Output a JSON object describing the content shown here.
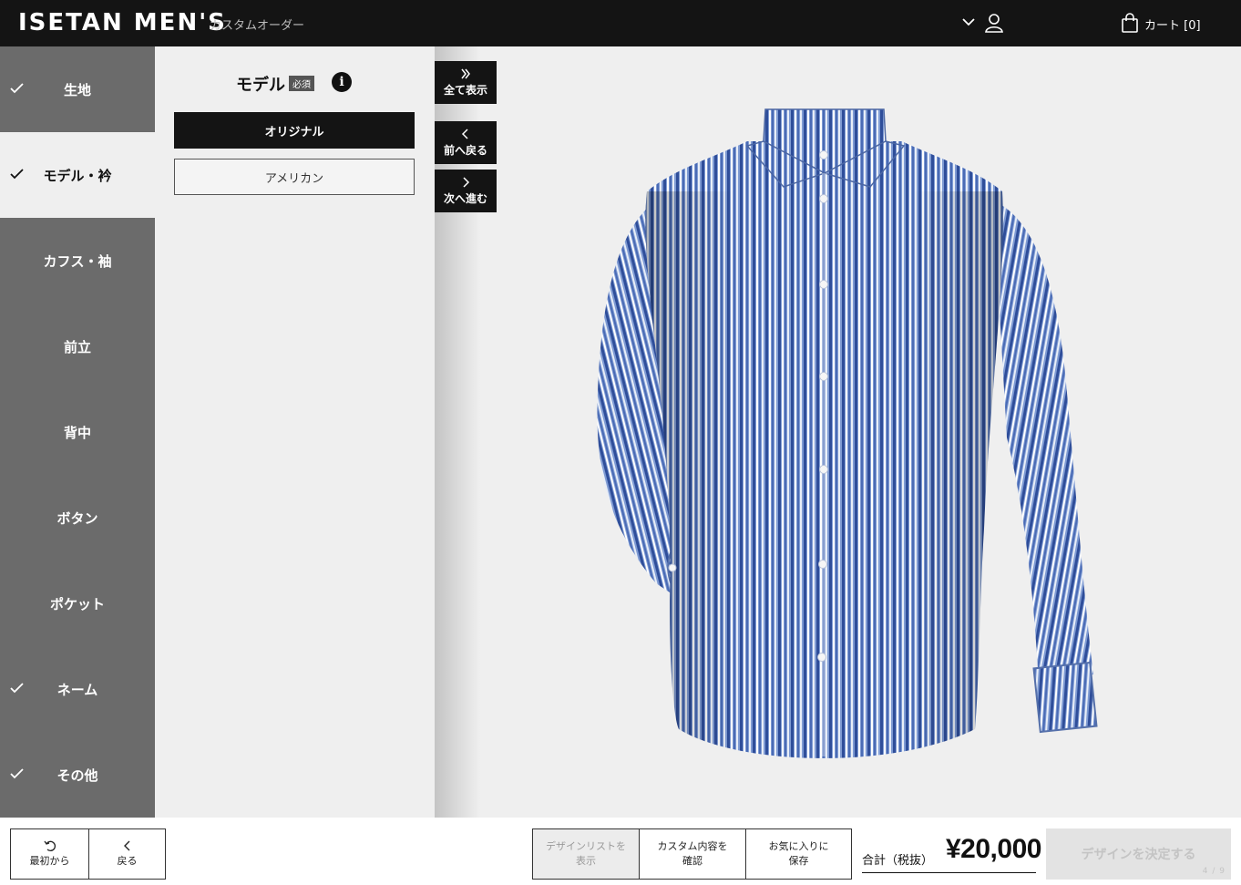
{
  "header": {
    "logo": "ISETAN MEN'S",
    "subtitle": "カスタムオーダー",
    "cart_label": "カート [0]"
  },
  "sidebar": {
    "items": [
      {
        "label": "生地",
        "checked": true
      },
      {
        "label": "モデル・衿",
        "checked": true,
        "active": true
      },
      {
        "label": "カフス・袖",
        "checked": false
      },
      {
        "label": "前立",
        "checked": false
      },
      {
        "label": "背中",
        "checked": false
      },
      {
        "label": "ボタン",
        "checked": false
      },
      {
        "label": "ポケット",
        "checked": false
      },
      {
        "label": "ネーム",
        "checked": true
      },
      {
        "label": "その他",
        "checked": true
      }
    ]
  },
  "panel": {
    "title": "モデル",
    "required_badge": "必須",
    "info_icon": "i",
    "options": [
      {
        "label": "オリジナル",
        "selected": true
      },
      {
        "label": "アメリカン",
        "selected": false
      }
    ]
  },
  "side_buttons": {
    "show_all": "全て表示",
    "prev": "前へ戻る",
    "next": "次へ進む"
  },
  "footer": {
    "restart": "最初から",
    "back": "戻る",
    "design_list_1": "デザインリストを",
    "design_list_2": "表示",
    "confirm_1": "カスタム内容を",
    "confirm_2": "確認",
    "favorite_1": "お気に入りに",
    "favorite_2": "保存",
    "total_label": "合計（税抜）",
    "total_price": "¥20,000",
    "decide": "デザインを決定する",
    "step": "4 / 9"
  },
  "colors": {
    "header_bg": "#141414",
    "sidebar_bg": "#6b6b6b",
    "shirt_blue": "#5d7fbf"
  }
}
